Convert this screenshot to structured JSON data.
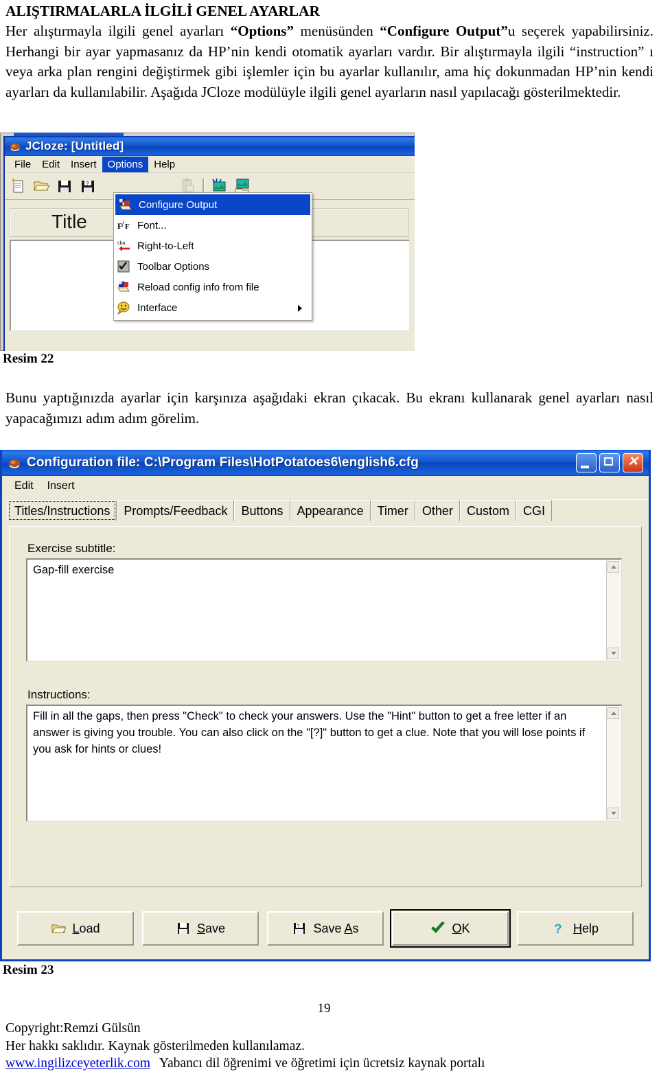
{
  "document": {
    "heading": "ALIŞTIRMALARLA İLGİLİ GENEL AYARLAR",
    "paragraph1_parts": {
      "t1": "Her alıştırmayla ilgili genel ayarları ",
      "b1": "“Options”",
      "t2": " menüsünden ",
      "b2": "“Configure Output”",
      "t3": "u seçerek yapabilirsiniz. Herhangi bir ayar yapmasanız da HP’nin kendi otomatik ayarları vardır. Bir alıştırmayla ilgili “instruction” ı veya arka plan rengini değiştirmek gibi işlemler için bu ayarlar kullanılır, ama hiç dokunmadan HP’nin kendi ayarları da kullanılabilir. Aşağıda JCloze modülüyle ilgili genel ayarların nasıl yapılacağı gösterilmektedir."
    },
    "caption_resim22": "Resim 22",
    "paragraph2": "Bunu yaptığınızda ayarlar için karşınıza aşağıdaki ekran çıkacak. Bu ekranı kullanarak genel ayarları nasıl yapacağımızı adım adım görelim.",
    "caption_resim23": "Resim 23",
    "page_number": "19",
    "footer_line1": "Copyright:Remzi Gülsün",
    "footer_line2": "Her hakkı saklıdır. Kaynak gösterilmeden kullanılamaz.",
    "footer_link": "www.ingilizceyeterlik.com",
    "footer_line3": "Yabancı dil öğrenimi ve öğretimi için ücretsiz kaynak portalı"
  },
  "jcloze_window": {
    "title": "JCloze: [Untitled]",
    "menus": [
      {
        "label": "File",
        "active": false
      },
      {
        "label": "Edit",
        "active": false
      },
      {
        "label": "Insert",
        "active": false
      },
      {
        "label": "Options",
        "active": true
      },
      {
        "label": "Help",
        "active": false
      }
    ],
    "toolbar_icons": [
      "new-document-icon",
      "open-folder-icon",
      "save-disk-icon",
      "save-as-disk-icon",
      "paste-clipboard-icon",
      "export-webpage-icon",
      "export-to-browser-icon"
    ],
    "title_field_label": "Title",
    "options_menu": [
      {
        "label": "Configure Output",
        "icon": "configure-output-icon",
        "selected": true,
        "submenu": false
      },
      {
        "label": "Font...",
        "icon": "font-icon",
        "selected": false,
        "submenu": false
      },
      {
        "label": "Right-to-Left",
        "icon": "right-to-left-icon",
        "selected": false,
        "submenu": false
      },
      {
        "label": "Toolbar Options",
        "icon": "toolbar-options-icon",
        "selected": false,
        "submenu": false
      },
      {
        "label": "Reload config info from file",
        "icon": "reload-config-icon",
        "selected": false,
        "submenu": false
      },
      {
        "label": "Interface",
        "icon": "interface-icon",
        "selected": false,
        "submenu": true
      }
    ]
  },
  "config_dialog": {
    "title": "Configuration file: C:\\Program Files\\HotPotatoes6\\english6.cfg",
    "window_buttons": [
      {
        "name": "minimize-button",
        "glyph": "_"
      },
      {
        "name": "maximize-button",
        "glyph": "□"
      },
      {
        "name": "close-button",
        "glyph": "✕"
      }
    ],
    "menus": [
      {
        "label": "Edit"
      },
      {
        "label": "Insert"
      }
    ],
    "tabs": [
      {
        "label": "Titles/Instructions",
        "selected": true
      },
      {
        "label": "Prompts/Feedback",
        "selected": false
      },
      {
        "label": "Buttons",
        "selected": false
      },
      {
        "label": "Appearance",
        "selected": false
      },
      {
        "label": "Timer",
        "selected": false
      },
      {
        "label": "Other",
        "selected": false
      },
      {
        "label": "Custom",
        "selected": false
      },
      {
        "label": "CGI",
        "selected": false
      }
    ],
    "fields": {
      "subtitle_label": "Exercise subtitle:",
      "subtitle_value": "Gap-fill exercise",
      "instructions_label": "Instructions:",
      "instructions_value": "Fill in all the gaps, then press \"Check\" to check your answers. Use the \"Hint\" button to get a free letter if an answer is giving you trouble. You can also click on the \"[?]\" button to get a clue. Note that you will lose points if you ask for hints or clues!"
    },
    "buttons": [
      {
        "label_pre": "",
        "label_u": "L",
        "label_post": "oad",
        "icon": "open-folder-icon",
        "default": false,
        "name": "load-button"
      },
      {
        "label_pre": "",
        "label_u": "S",
        "label_post": "ave",
        "icon": "save-disk-icon",
        "default": false,
        "name": "save-button"
      },
      {
        "label_pre": "Save ",
        "label_u": "A",
        "label_post": "s",
        "icon": "save-as-disk-icon",
        "default": false,
        "name": "save-as-button"
      },
      {
        "label_pre": "",
        "label_u": "O",
        "label_post": "K",
        "icon": "green-check-icon",
        "default": true,
        "name": "ok-button"
      },
      {
        "label_pre": "",
        "label_u": "H",
        "label_post": "elp",
        "icon": "question-mark-icon",
        "default": false,
        "name": "help-button"
      }
    ]
  },
  "colors": {
    "titlebar_blue": "#0a45bb",
    "dialog_face": "#ece9d8",
    "menu_highlight": "#0a46c8",
    "close_red": "#cf3414",
    "link_blue": "#0000cc"
  }
}
